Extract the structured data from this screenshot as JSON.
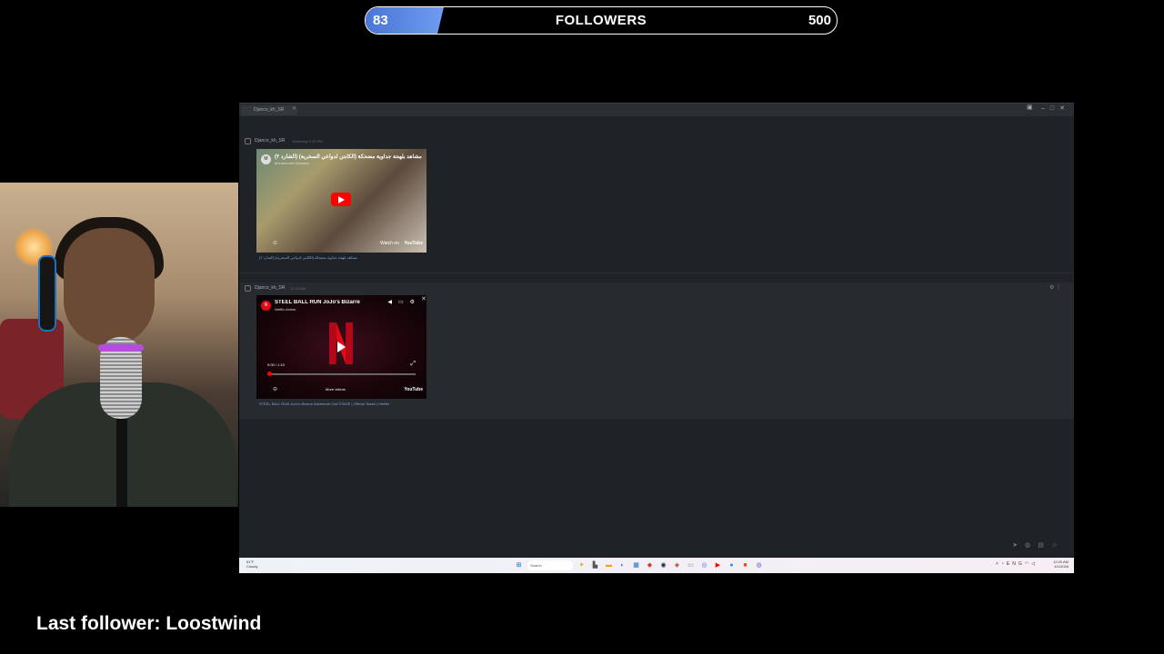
{
  "goal": {
    "label": "FOLLOWERS",
    "current": "83",
    "target": "500",
    "progress": 0.166,
    "fill_color": "#5b8ae6"
  },
  "last_follower": "Last follower: Loostwind",
  "app": {
    "tab_title": "Djanco_kh_SR",
    "header_icon": "inbox-icon",
    "messages": [
      {
        "author": "Djanco_kh_SR",
        "time": "Yesterday 5:26 PM",
        "embed": {
          "channel": "Mohammad Alashawi",
          "title": "مشاهد بلهجة جداوية مضحكة (الكابتن لدواعي السخرية) (الشارد ٢)",
          "watch_on": "Watch on",
          "platform": "YouTube",
          "play": "play-icon"
        },
        "caption": "مشاهد بلهجة جداوية مضحكة (الكابتن لدواعي السخرية) (الشارد ٢)"
      },
      {
        "author": "Djanco_kh_SR",
        "time": "12:20 AM",
        "embed": {
          "channel": "Netflix Anime",
          "title": "STEEL BALL RUN JoJo's Bizarre",
          "time_label": "0:00 / 1:10",
          "more_videos": "More videos",
          "platform": "YouTube"
        },
        "caption": "STEEL BALL RUN JoJo's Bizarre Adventure 2nd STAGE | Official Teaser | Netflix"
      }
    ]
  },
  "taskbar": {
    "weather_temp": "51°F",
    "weather_desc": "Cloudy",
    "search_placeholder": "Search",
    "tray_time": "12:20 AM",
    "tray_date": "4/1/2026",
    "tray_lang": "ENG"
  }
}
